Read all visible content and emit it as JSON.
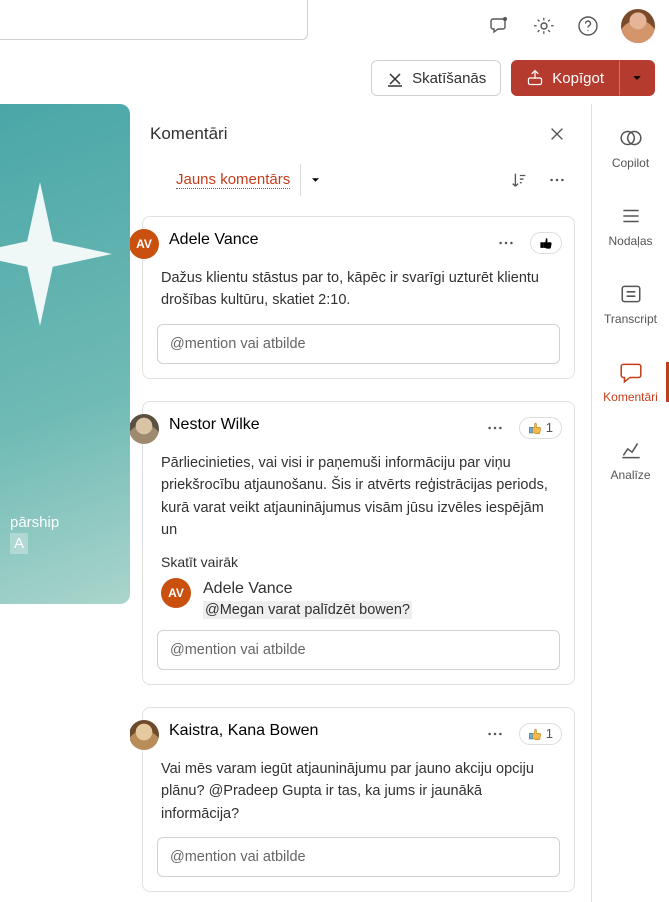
{
  "header": {
    "view_button": "Skatīšanās",
    "share_button": "Kopīgot"
  },
  "slide": {
    "line1": "pārship",
    "line2": "A"
  },
  "comments_panel": {
    "title": "Komentāri",
    "new_comment": "Jauns komentārs",
    "reply_placeholder": "@mention vai atbilde",
    "see_more": "Skatīt vairāk"
  },
  "right_rail": {
    "items": [
      {
        "label": "Copilot"
      },
      {
        "label": "Nodaļas"
      },
      {
        "label": "Transcript"
      },
      {
        "label": "Komentāri"
      },
      {
        "label": "Analīze"
      }
    ]
  },
  "comments": [
    {
      "author": "Adele Vance",
      "avatar_initials": "AV",
      "body": "Dažus klientu stāstus par to, kāpēc ir svarīgi uzturēt klientu drošības kultūru, skatiet 2:10.",
      "like_count": ""
    },
    {
      "author": "Nestor Wilke",
      "body": "Pārliecinieties, vai visi ir paņemuši informāciju par viņu priekšrocību atjaunošanu. Šis ir atvērts reģistrācijas periods, kurā varat veikt atjauninājumus visām jūsu izvēles iespējām un",
      "like_count": "1",
      "reply": {
        "author": "Adele Vance",
        "avatar_initials": "AV",
        "text": "@Megan varat palīdzēt bowen?"
      }
    },
    {
      "author": "Kaistra, Kana Bowen",
      "body": "Vai mēs varam iegūt atjauninājumu par jauno akciju opciju plānu? @Pradeep Gupta ir tas, ka jums ir jaunākā informācija?",
      "like_count": "1"
    }
  ]
}
